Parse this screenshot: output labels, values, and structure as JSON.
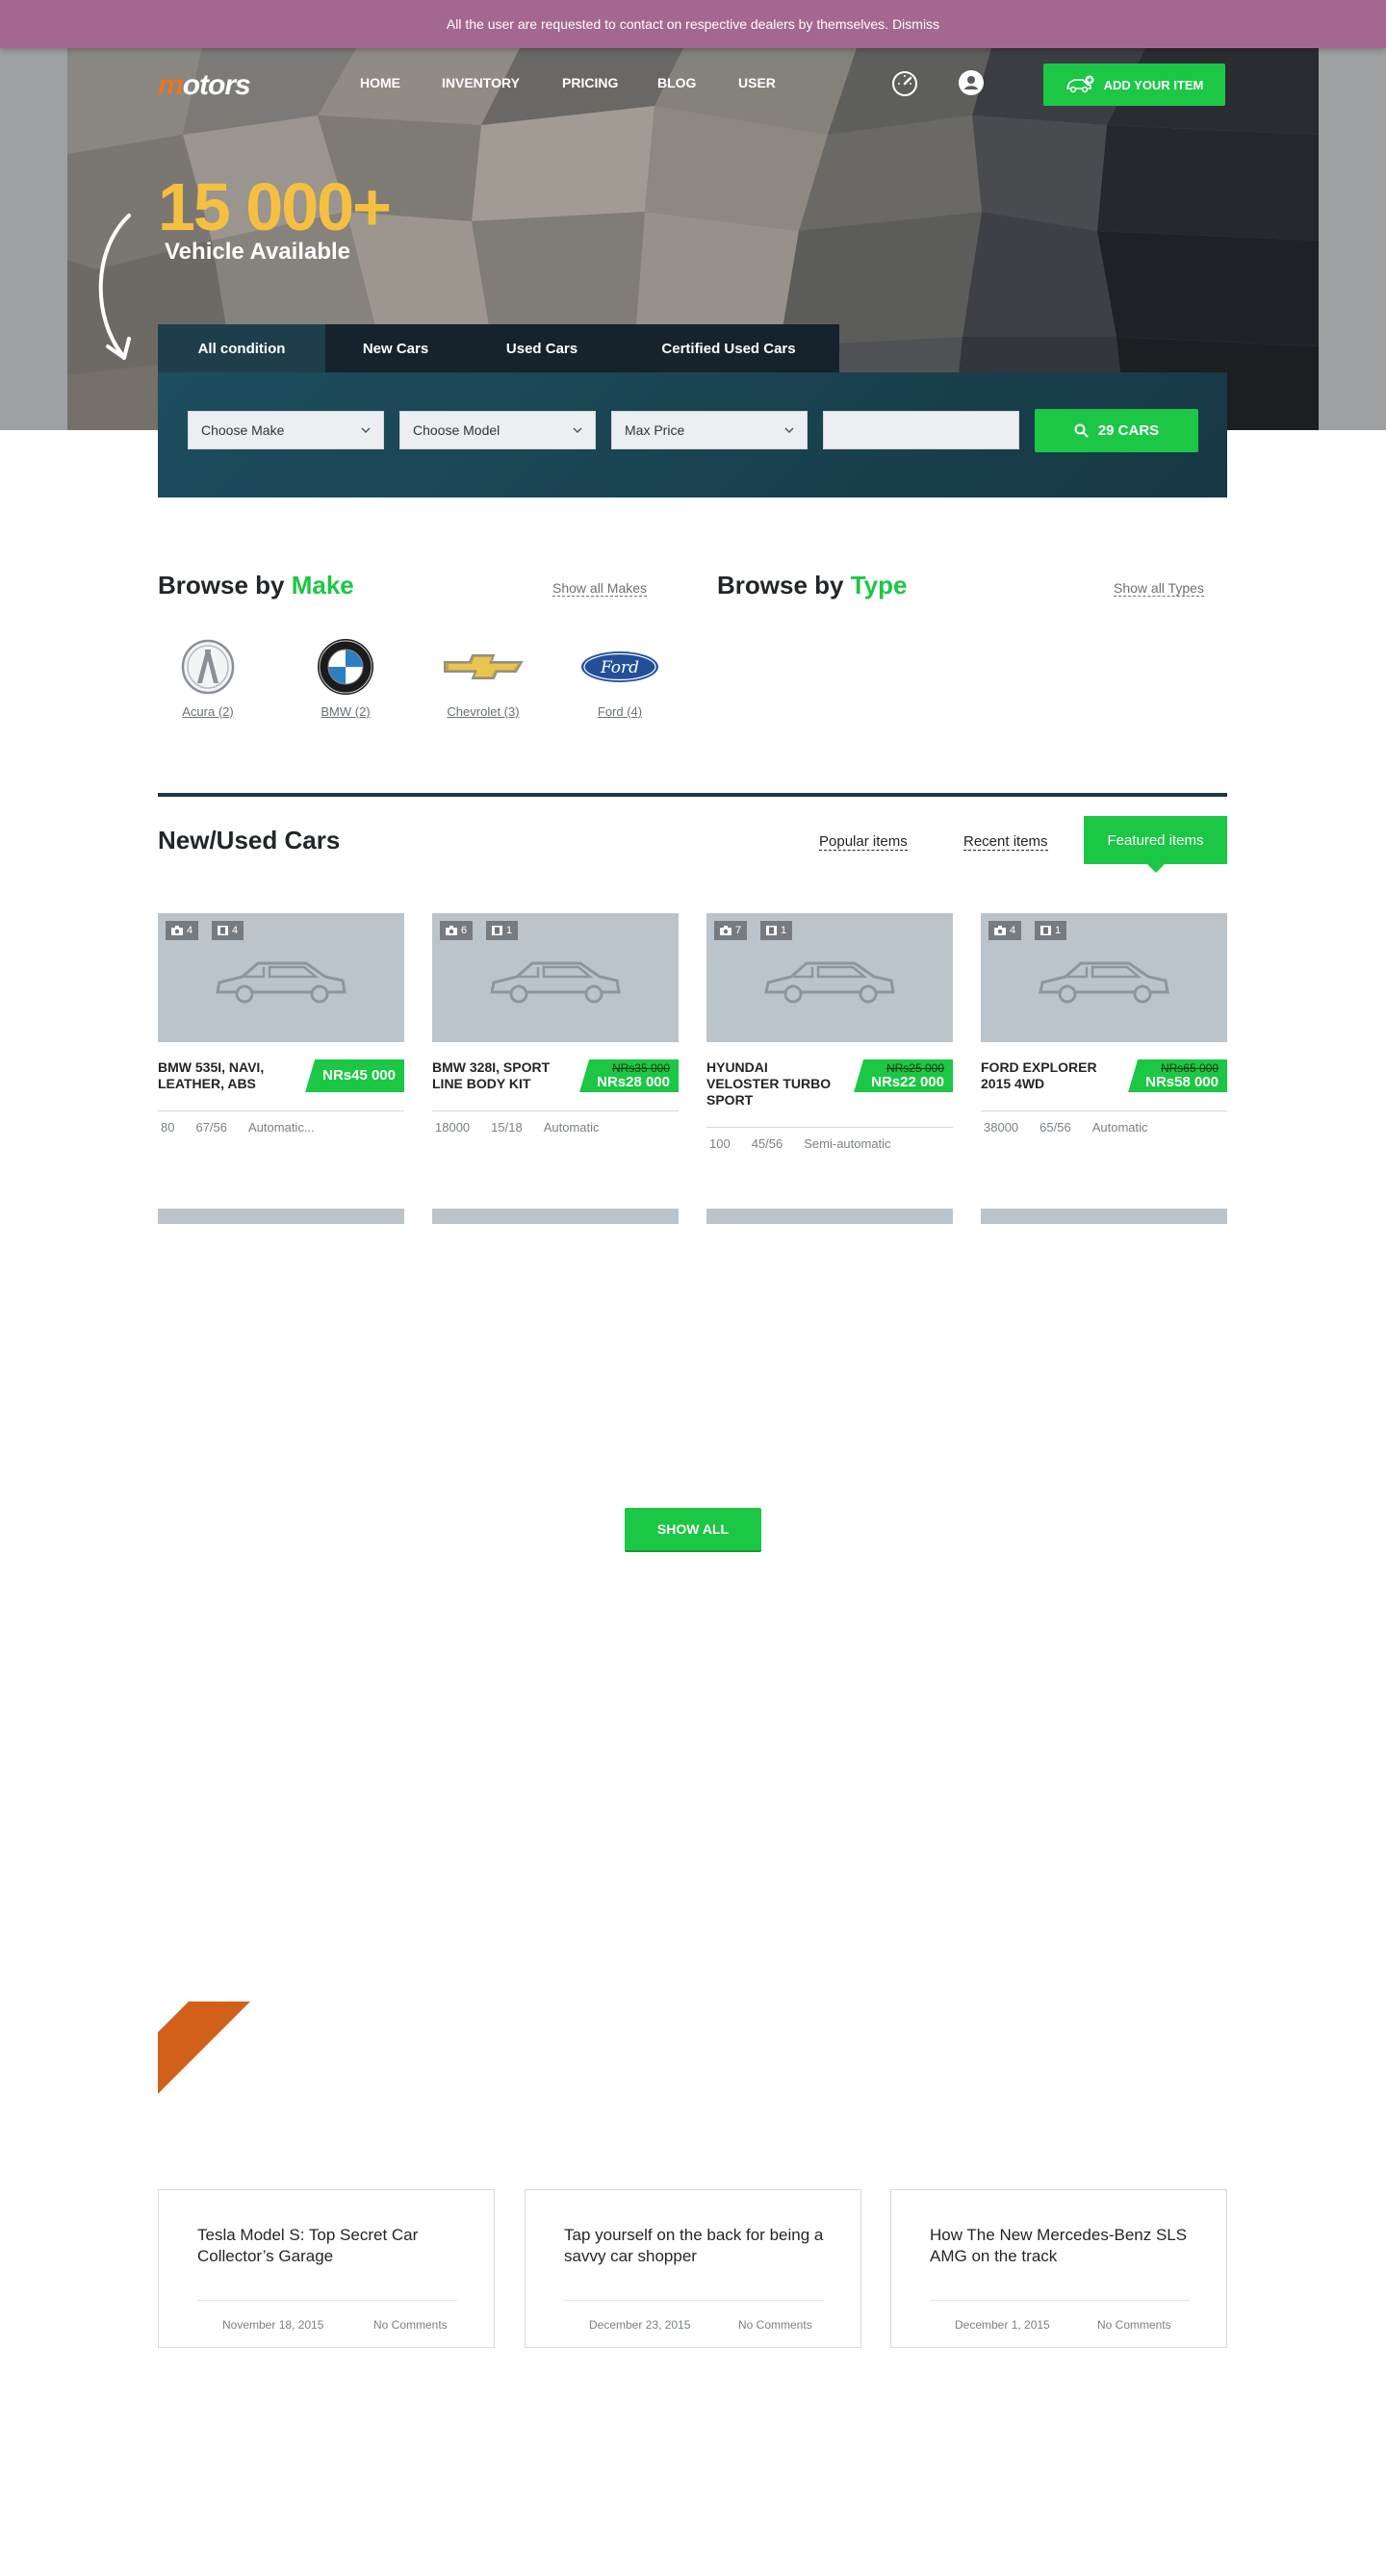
{
  "notice": {
    "text": "All the user are requested to contact on respective dealers by themselves.",
    "dismiss": "Dismiss"
  },
  "header": {
    "logo_accent": "m",
    "logo_rest": "otors",
    "nav": [
      "HOME",
      "INVENTORY",
      "PRICING",
      "BLOG",
      "USER"
    ],
    "add_button": "ADD YOUR ITEM"
  },
  "hero": {
    "count": "15 000+",
    "subtitle": "Vehicle Available"
  },
  "search": {
    "tabs": [
      "All condition",
      "New Cars",
      "Used Cars",
      "Certified Used Cars"
    ],
    "active_tab": "All condition",
    "make_select": "Choose Make",
    "model_select": "Choose Model",
    "price_select": "Max Price",
    "keyword_value": "",
    "submit": "29 CARS"
  },
  "browse_make": {
    "prefix": "Browse by ",
    "highlight": "Make",
    "show_all": "Show all Makes",
    "makes": [
      {
        "label": "Acura (2)",
        "icon": "acura-logo"
      },
      {
        "label": "BMW (2)",
        "icon": "bmw-logo"
      },
      {
        "label": "Chevrolet (3)",
        "icon": "chevrolet-logo"
      },
      {
        "label": "Ford (4)",
        "icon": "ford-logo"
      }
    ]
  },
  "browse_type": {
    "prefix": "Browse by ",
    "highlight": "Type",
    "show_all": "Show all Types"
  },
  "listings": {
    "title": "New/Used Cars",
    "filters": [
      "Popular items",
      "Recent items",
      "Featured items"
    ],
    "active_filter": "Featured items",
    "cars": [
      {
        "title": "BMW 535I, NAVI, LEATHER, ABS",
        "photos": "4",
        "videos": "4",
        "old_price": "",
        "price": "NRs45 000",
        "mileage": "80",
        "mpg": "67/56",
        "transmission": "Automatic..."
      },
      {
        "title": "BMW 328I, SPORT LINE BODY KIT",
        "photos": "6",
        "videos": "1",
        "old_price": "NRs35 000",
        "price": "NRs28 000",
        "mileage": "18000",
        "mpg": "15/18",
        "transmission": "Automatic"
      },
      {
        "title": "HYUNDAI VELOSTER TURBO SPORT",
        "photos": "7",
        "videos": "1",
        "old_price": "NRs25 000",
        "price": "NRs22 000",
        "mileage": "100",
        "mpg": "45/56",
        "transmission": "Semi-automatic"
      },
      {
        "title": "FORD EXPLORER 2015 4WD",
        "photos": "4",
        "videos": "1",
        "old_price": "NRs65 000",
        "price": "NRs58 000",
        "mileage": "38000",
        "mpg": "65/56",
        "transmission": "Automatic"
      }
    ],
    "show_all": "SHOW ALL"
  },
  "blog": {
    "posts": [
      {
        "title": "Tesla Model S: Top Secret Car Collector’s Garage",
        "date": "November 18, 2015",
        "comments": "No Comments"
      },
      {
        "title": "Tap yourself on the back for being a savvy car shopper",
        "date": "December 23, 2015",
        "comments": "No Comments"
      },
      {
        "title": "How The New Mercedes-Benz SLS AMG on the track",
        "date": "December 1, 2015",
        "comments": "No Comments"
      }
    ]
  },
  "colors": {
    "accent": "#1bc744",
    "gold": "#f5c042",
    "notice": "#a4678f",
    "panel": "#1d4e5e",
    "corner": "#d2601a"
  }
}
